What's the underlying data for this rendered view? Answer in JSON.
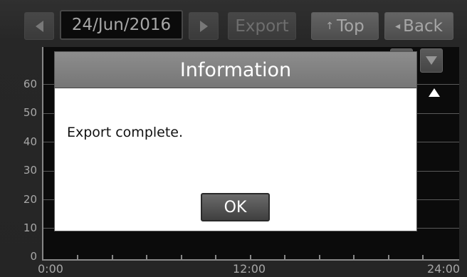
{
  "toolbar": {
    "prev_icon": "left-arrow-icon",
    "date": "24/Jun/2016",
    "next_icon": "right-arrow-icon",
    "export_label": "Export",
    "top_label": "Top",
    "top_glyph": "↑",
    "back_label": "Back",
    "back_glyph": "◂"
  },
  "chart_data": {
    "type": "line",
    "y_ticks": [
      "60",
      "50",
      "40",
      "30",
      "20",
      "10",
      "0"
    ],
    "x_ticks": [
      "0:00",
      "12:00",
      "24:00"
    ],
    "ylim": [
      0,
      60
    ],
    "grid": true,
    "series": []
  },
  "dialog": {
    "title": "Information",
    "message": "Export complete.",
    "ok_label": "OK"
  },
  "colors": {
    "background": "#3c3c3c",
    "dialog_title_bar": "#7d7d7d",
    "dialog_body": "#ffffff",
    "chart_bg": "#111111"
  }
}
